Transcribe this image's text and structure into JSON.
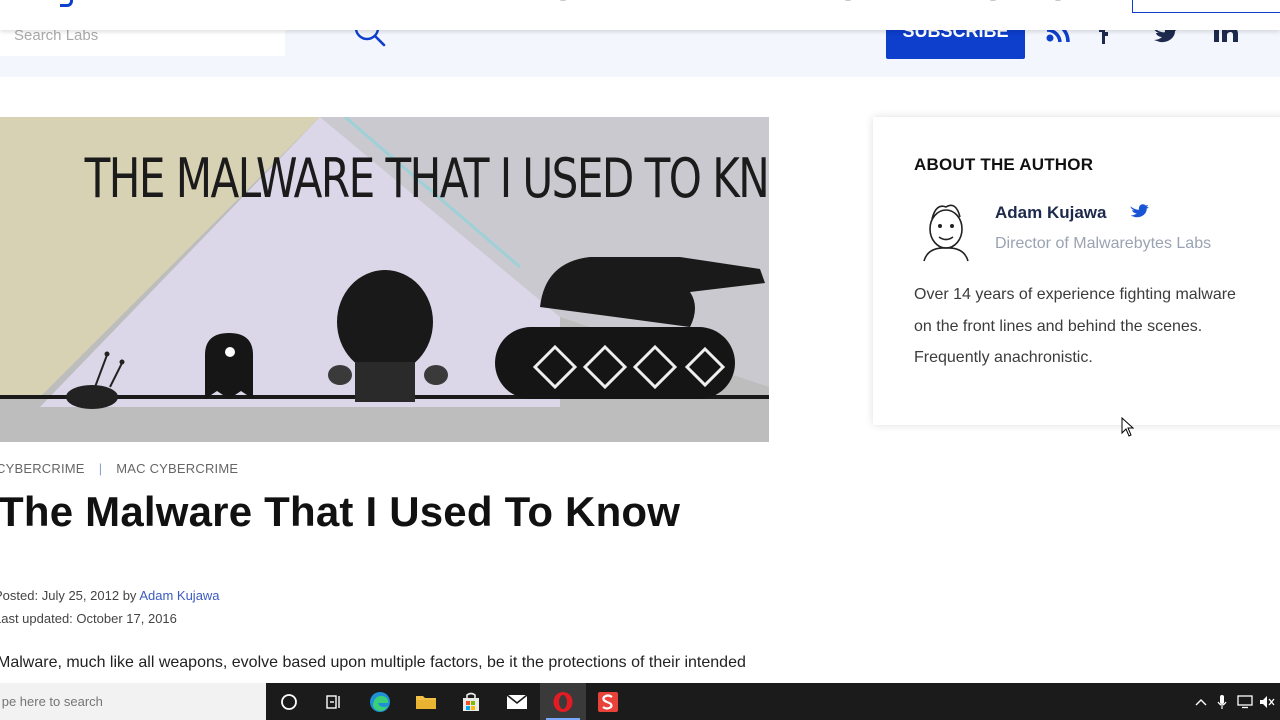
{
  "header": {
    "search_placeholder": "Search Labs",
    "subscribe_label": "SUBSCRIBE",
    "accent_color": "#0d3ecc",
    "social_icons": [
      "rss-icon",
      "facebook-icon",
      "twitter-icon",
      "linkedin-icon"
    ]
  },
  "hero": {
    "image_text": "THE MALWARE THAT I USED TO KNOW"
  },
  "article": {
    "categories": [
      "CYBERCRIME",
      "MAC CYBERCRIME"
    ],
    "category_separator": "|",
    "title": "The Malware That I Used To Know",
    "posted_label": "Posted:",
    "posted_date": "July 25, 2012",
    "by_label": "by",
    "author_link": "Adam Kujawa",
    "updated_label": "Last updated:",
    "updated_date": "October 17, 2016",
    "first_line": "Malware, much like all weapons, evolve based upon multiple factors, be it the protections of their intended"
  },
  "author_card": {
    "heading": "ABOUT THE AUTHOR",
    "name": "Adam Kujawa",
    "role": "Director of Malwarebytes Labs",
    "bio": "Over 14 years of experience fighting malware on the front lines and behind the scenes. Frequently anachronistic."
  },
  "taskbar": {
    "search_placeholder": "Type here to search",
    "apps": [
      "cortana-icon",
      "task-view-icon",
      "edge-icon",
      "file-explorer-icon",
      "store-icon",
      "mail-icon",
      "opera-icon",
      "snagit-icon"
    ],
    "active_app": "opera-icon",
    "tray": [
      "chevron-up-icon",
      "microphone-icon",
      "network-icon",
      "volume-muted-icon"
    ]
  }
}
